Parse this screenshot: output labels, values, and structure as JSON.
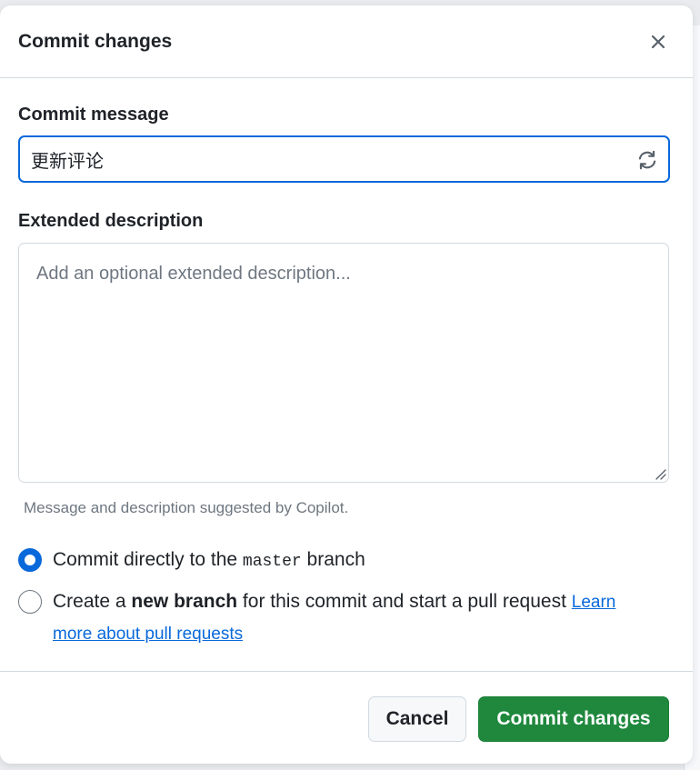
{
  "dialog": {
    "title": "Commit changes",
    "close_icon": "close-icon"
  },
  "commit_message": {
    "label": "Commit message",
    "value": "更新评论",
    "regenerate_icon": "sync-icon"
  },
  "extended_description": {
    "label": "Extended description",
    "placeholder": "Add an optional extended description...",
    "value": ""
  },
  "hint": "Message and description suggested by Copilot.",
  "options": {
    "direct": {
      "prefix": "Commit directly to the ",
      "branch_name": "master",
      "suffix": " branch",
      "selected": true
    },
    "new_branch": {
      "prefix": "Create a ",
      "bold": "new branch",
      "suffix": " for this commit and start a pull request ",
      "link_line1": "Learn",
      "link_line2": "more about pull requests",
      "selected": false
    }
  },
  "footer": {
    "cancel_label": "Cancel",
    "commit_label": "Commit changes"
  },
  "colors": {
    "accent": "#0969da",
    "primary_button": "#1f883d",
    "border": "#d1d9e0",
    "muted_text": "#6e7781"
  }
}
